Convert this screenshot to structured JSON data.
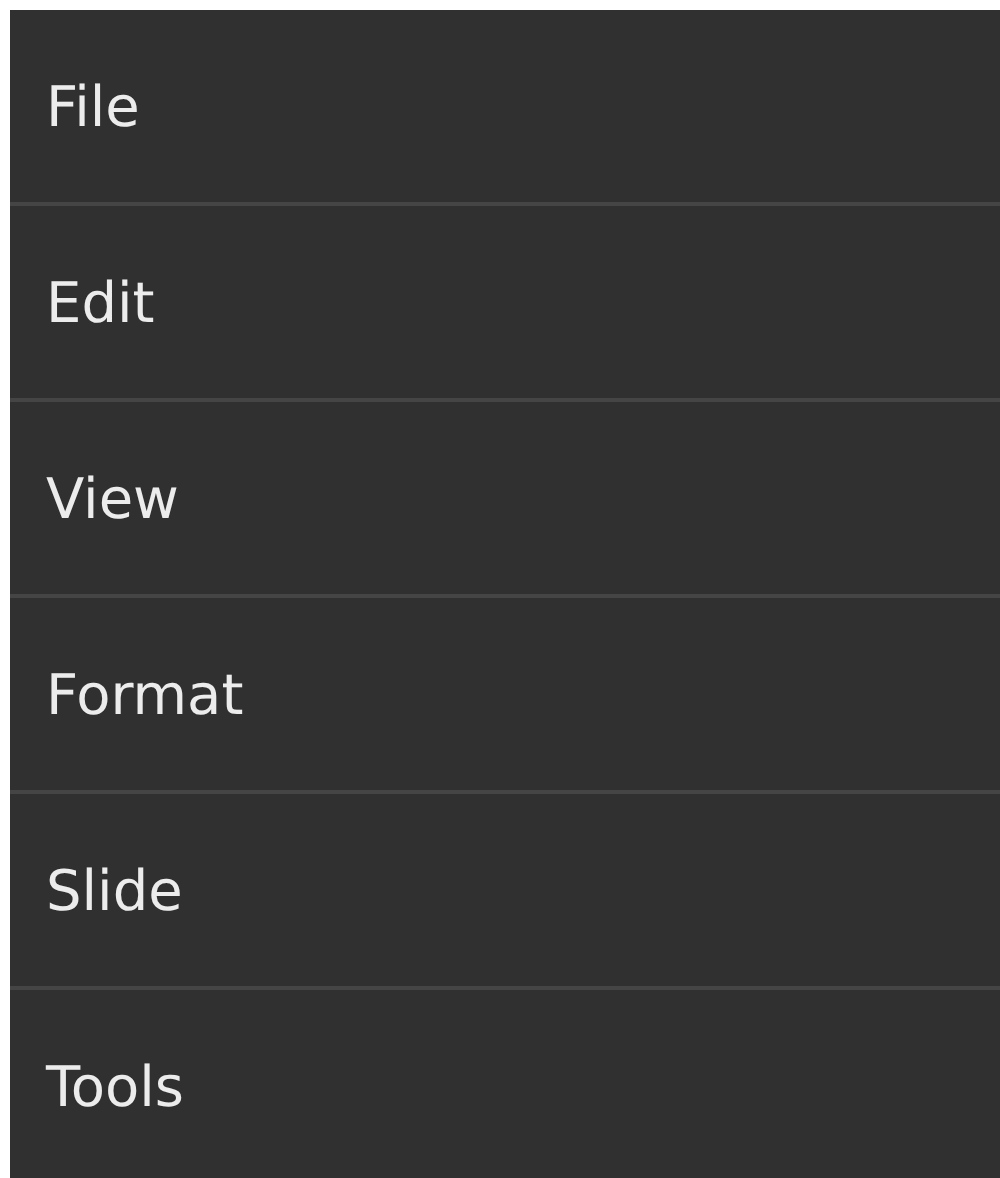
{
  "menu": {
    "items": [
      {
        "label": "File"
      },
      {
        "label": "Edit"
      },
      {
        "label": "View"
      },
      {
        "label": "Format"
      },
      {
        "label": "Slide"
      },
      {
        "label": "Tools"
      }
    ]
  }
}
